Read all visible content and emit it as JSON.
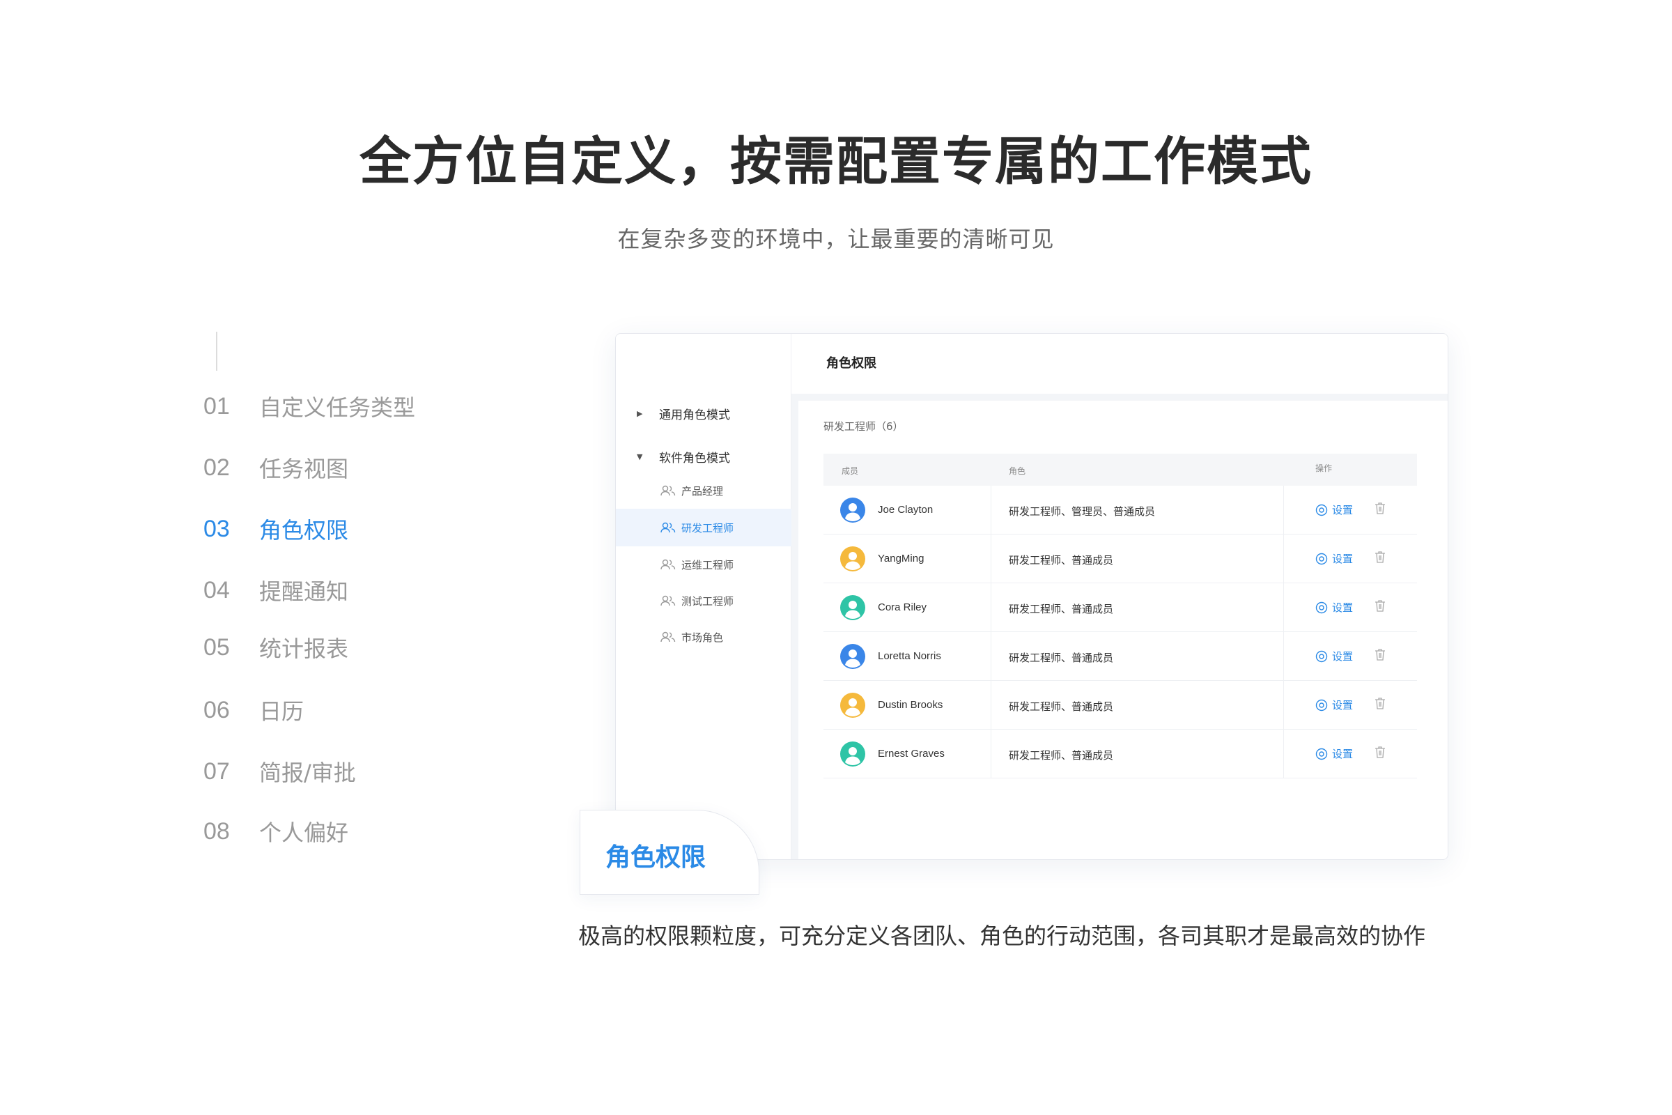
{
  "hero": {
    "title": "全方位自定义，按需配置专属的工作模式",
    "subtitle": "在复杂多变的环境中，让最重要的清晰可见"
  },
  "nav": {
    "items": [
      {
        "num": "01",
        "label": "自定义任务类型"
      },
      {
        "num": "02",
        "label": "任务视图"
      },
      {
        "num": "03",
        "label": "角色权限",
        "active": true
      },
      {
        "num": "04",
        "label": "提醒通知"
      },
      {
        "num": "05",
        "label": "统计报表"
      },
      {
        "num": "06",
        "label": "日历"
      },
      {
        "num": "07",
        "label": "简报/审批"
      },
      {
        "num": "08",
        "label": "个人偏好"
      }
    ]
  },
  "app": {
    "sidebar": {
      "groups": [
        {
          "label": "通用角色模式",
          "expanded": false
        },
        {
          "label": "软件角色模式",
          "expanded": true
        }
      ],
      "roles": [
        {
          "label": "产品经理"
        },
        {
          "label": "研发工程师",
          "active": true
        },
        {
          "label": "运维工程师"
        },
        {
          "label": "测试工程师"
        },
        {
          "label": "市场角色"
        }
      ]
    },
    "header": {
      "title": "角色权限"
    },
    "group_caption": "研发工程师（6）",
    "table": {
      "columns": {
        "member": "成员",
        "role": "角色",
        "action": "操作"
      },
      "set_label": "设置",
      "rows": [
        {
          "name": "Joe Clayton",
          "roles": "研发工程师、管理员、普通成员",
          "avatar_color": "#3a86e8"
        },
        {
          "name": "YangMing",
          "roles": "研发工程师、普通成员",
          "avatar_color": "#f5b93c"
        },
        {
          "name": "Cora Riley",
          "roles": "研发工程师、普通成员",
          "avatar_color": "#2ec4a6"
        },
        {
          "name": "Loretta Norris",
          "roles": "研发工程师、普通成员",
          "avatar_color": "#3a86e8"
        },
        {
          "name": "Dustin Brooks",
          "roles": "研发工程师、普通成员",
          "avatar_color": "#f5b93c"
        },
        {
          "name": "Ernest Graves",
          "roles": "研发工程师、普通成员",
          "avatar_color": "#2ec4a6"
        }
      ]
    }
  },
  "badge": {
    "label": "角色权限"
  },
  "caption": "极高的权限颗粒度，可充分定义各团队、角色的行动范围，各司其职才是最高效的协作",
  "colors": {
    "accent": "#2b8ae6",
    "muted": "#999999"
  }
}
